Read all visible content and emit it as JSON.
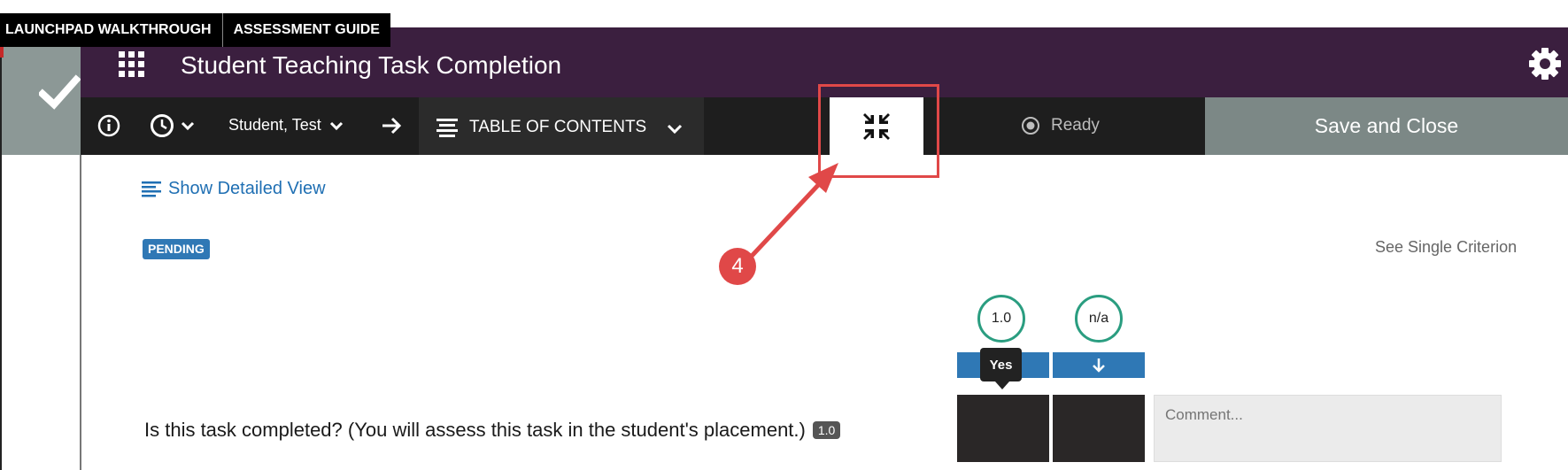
{
  "top_tabs": {
    "launchpad": "LAUNCHPAD WALKTHROUGH",
    "assessment": "ASSESSMENT GUIDE"
  },
  "header": {
    "title": "Student Teaching Task Completion",
    "student": "Student, Test",
    "toc": "TABLE OF CONTENTS",
    "status": "Ready",
    "save_close": "Save and Close"
  },
  "content": {
    "detailed_view": "Show Detailed View",
    "pending_badge": "PENDING",
    "single_criterion": "See Single Criterion",
    "columns": [
      {
        "score": "1.0",
        "tooltip": "Yes"
      },
      {
        "score": "n/a"
      }
    ],
    "question": "Is this task completed? (You will assess this task in the student's placement.)",
    "question_score": "1.0",
    "comment_placeholder": "Comment..."
  },
  "annotation": {
    "step_number": "4",
    "color": "#e04848"
  },
  "colors": {
    "header_purple": "#3b1f3f",
    "toolbar_dark": "#1e1e1e",
    "save_gray": "#7c8886",
    "accent_blue": "#2f78b5",
    "circle_green": "#2a9d80"
  }
}
